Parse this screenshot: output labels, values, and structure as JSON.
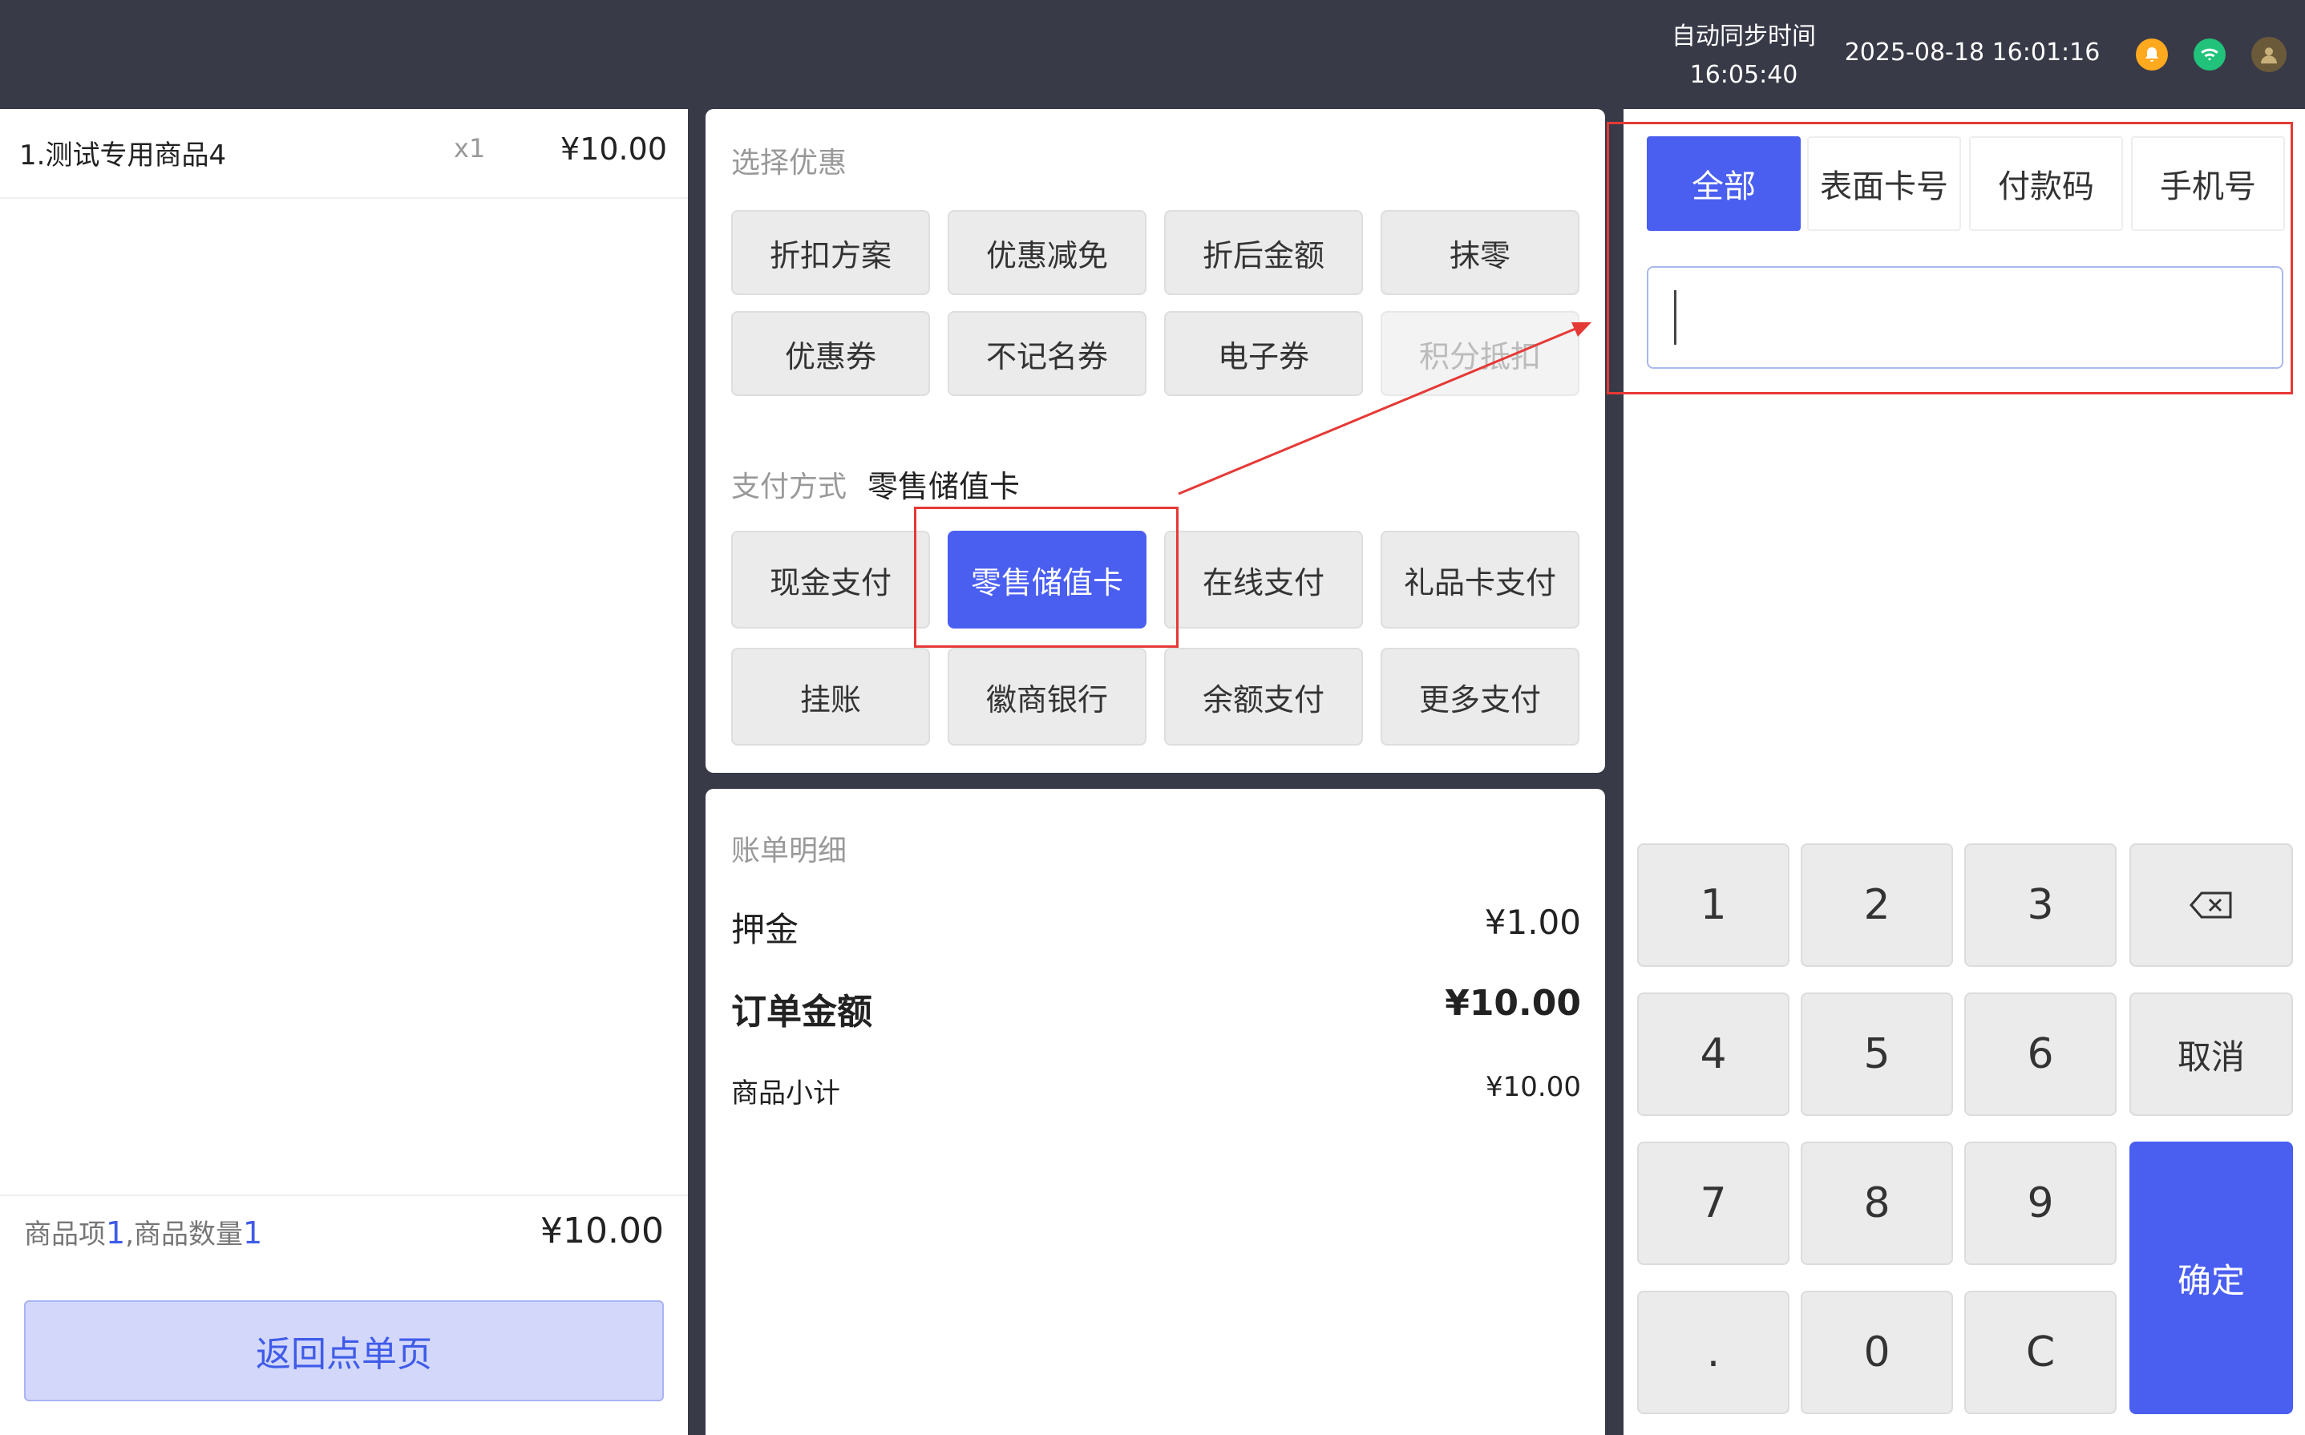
{
  "topbar": {
    "sync_label": "自动同步时间",
    "sync_time": "16:05:40",
    "datetime": "2025-08-18 16:01:16",
    "icons": [
      "bell-icon",
      "wifi-icon",
      "avatar"
    ]
  },
  "order": {
    "items": [
      {
        "name": "1.测试专用商品4",
        "qty": "x1",
        "price": "¥10.00"
      }
    ],
    "summary": {
      "label_items": "商品项",
      "items_count": "1",
      "label_qty": ",商品数量",
      "qty_count": "1",
      "total": "¥10.00"
    },
    "back_label": "返回点单页"
  },
  "discount": {
    "title": "选择优惠",
    "buttons": [
      "折扣方案",
      "优惠减免",
      "折后金额",
      "抹零",
      "优惠券",
      "不记名券",
      "电子券",
      "积分抵扣"
    ]
  },
  "payment": {
    "title": "支付方式",
    "current": "零售储值卡",
    "buttons": [
      "现金支付",
      "零售储值卡",
      "在线支付",
      "礼品卡支付",
      "挂账",
      "徽商银行",
      "余额支付",
      "更多支付"
    ]
  },
  "bill": {
    "title": "账单明细",
    "deposit_label": "押金",
    "deposit_value": "¥1.00",
    "order_amount_label": "订单金额",
    "order_amount_value": "¥10.00",
    "subtotal_label": "商品小计",
    "subtotal_value": "¥10.00"
  },
  "card_search": {
    "tabs": [
      "全部",
      "表面卡号",
      "付款码",
      "手机号"
    ],
    "active_tab": "全部",
    "input_value": ""
  },
  "keypad": {
    "keys": [
      "1",
      "2",
      "3",
      "4",
      "5",
      "6",
      "7",
      "8",
      "9",
      ".",
      "0",
      "C"
    ],
    "cancel_label": "取消",
    "confirm_label": "确定",
    "backspace_icon": "backspace-icon"
  },
  "colors": {
    "accent": "#4a5ef0",
    "topbar": "#383a48",
    "annotation": "#e53935"
  }
}
